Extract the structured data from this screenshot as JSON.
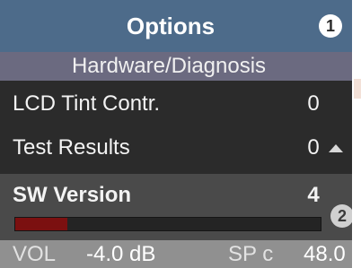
{
  "header": {
    "title": "Options",
    "badge": "1"
  },
  "subheader": {
    "title": "Hardware/Diagnosis"
  },
  "menu": {
    "items": [
      {
        "label": "LCD Tint Contr.",
        "value": "0"
      },
      {
        "label": "Test Results",
        "value": "0"
      }
    ],
    "selected": {
      "label": "SW Version",
      "value": "4",
      "level_fraction": 0.17
    }
  },
  "callout": {
    "badge": "2"
  },
  "status": {
    "vol_label": "VOL",
    "vol_value": "-4.0 dB",
    "sp_label": "SP c",
    "sp_value": "48.0"
  },
  "icons": {
    "scroll": "scroll-up-icon"
  },
  "colors": {
    "header": "#4d6b8a",
    "subheader": "#6b6a80",
    "screen": "#2b2b2b",
    "selected_row": "#4a4a4a",
    "level_fill": "#7b1010",
    "status_bar": "#909090"
  }
}
